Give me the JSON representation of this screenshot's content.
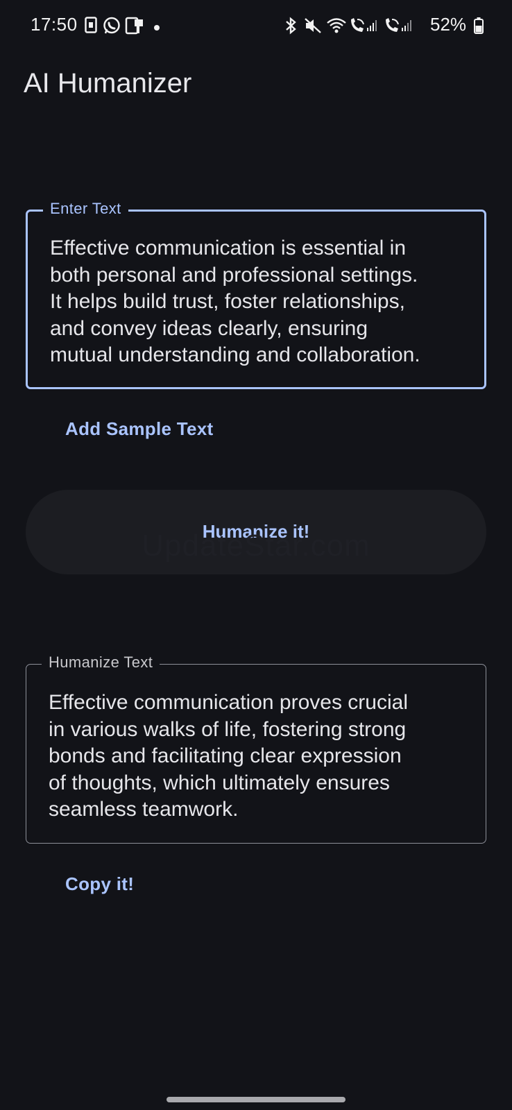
{
  "status_bar": {
    "time": "17:50",
    "battery_percent": "52%",
    "icons_left": [
      "sim-card-icon",
      "whatsapp-icon",
      "notification-icon",
      "dot-icon"
    ],
    "icons_right": [
      "bluetooth-icon",
      "mute-icon",
      "wifi-icon",
      "wifi-call-1-icon",
      "signal-1-icon",
      "wifi-call-2-icon",
      "signal-2-icon",
      "battery-icon"
    ]
  },
  "app": {
    "title": "AI Humanizer"
  },
  "input_field": {
    "label": "Enter Text",
    "value": "Effective communication is essential in\nboth personal and professional settings.\nIt helps build trust, foster relationships,\nand convey ideas clearly, ensuring\nmutual understanding and collaboration."
  },
  "buttons": {
    "sample": "Add Sample Text",
    "humanize": "Humanize it!",
    "copy": "Copy it!"
  },
  "watermark": "UpdateStar.com",
  "output_field": {
    "label": "Humanize Text",
    "value": "Effective communication proves crucial\nin various walks of life, fostering strong\nbonds and facilitating clear expression\nof thoughts, which ultimately ensures\nseamless teamwork."
  },
  "colors": {
    "background": "#121318",
    "accent": "#aac4ff",
    "button_fill": "#1c1d22",
    "text": "#e6e6ea"
  }
}
